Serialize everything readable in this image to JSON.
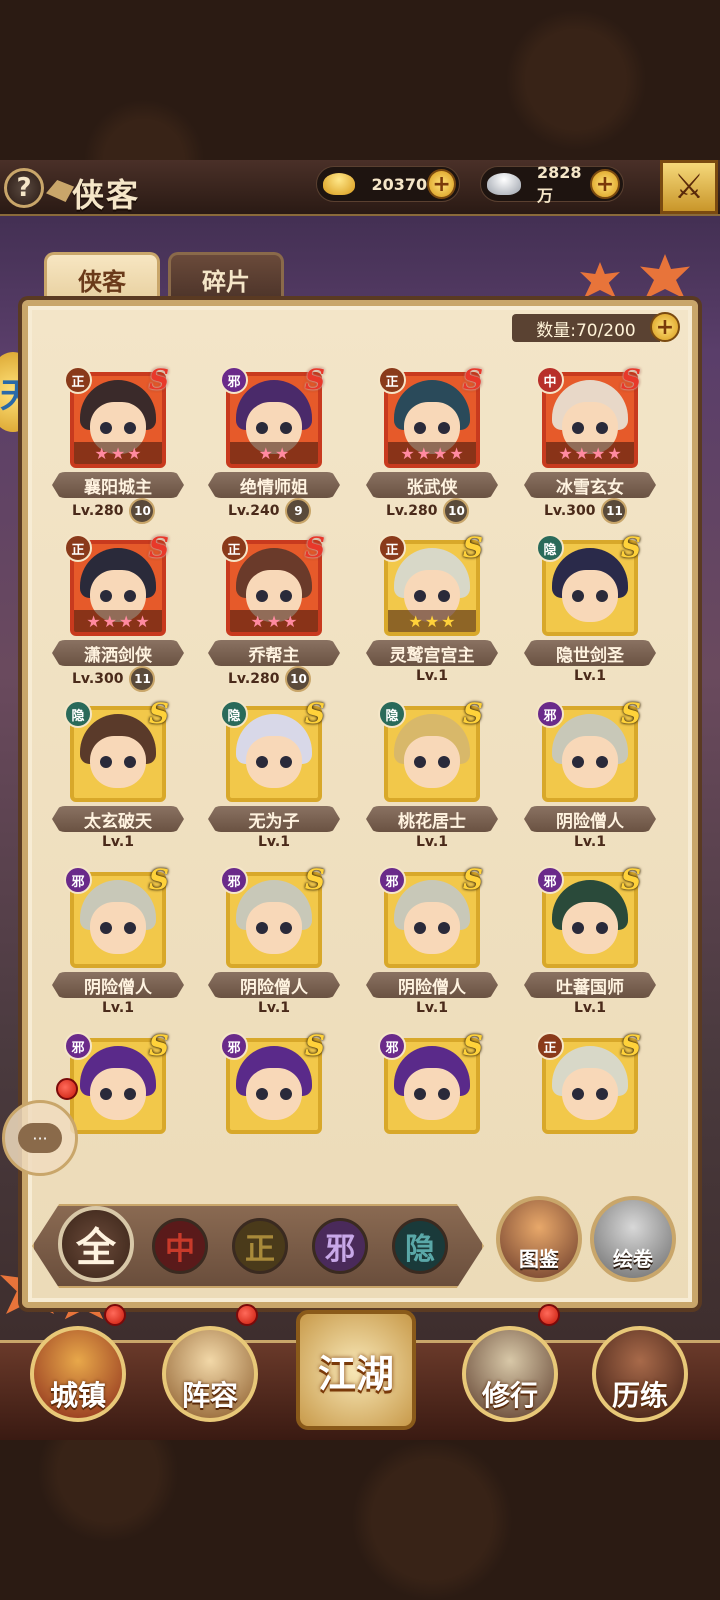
{
  "header": {
    "title": "侠客",
    "gold": "20370",
    "silver": "2828万",
    "help_icon": "question-icon",
    "close_icon": "crossed-swords-icon"
  },
  "tabs": [
    {
      "label": "侠客",
      "active": true
    },
    {
      "label": "碎片",
      "active": false
    }
  ],
  "count_label": "数量:70/200",
  "left_emblem": "天",
  "heroes": [
    {
      "name": "襄阳城主",
      "level": "Lv.280",
      "awaken": "10",
      "faction": "正",
      "rank": "S",
      "rank_color": "red",
      "stars": 3,
      "star_color": "pink",
      "frame": "red"
    },
    {
      "name": "绝情师姐",
      "level": "Lv.240",
      "awaken": "9",
      "faction": "邪",
      "rank": "S",
      "rank_color": "red",
      "stars": 2,
      "star_color": "pink",
      "frame": "red"
    },
    {
      "name": "张武侠",
      "level": "Lv.280",
      "awaken": "10",
      "faction": "正",
      "rank": "S",
      "rank_color": "red",
      "stars": 4,
      "star_color": "pink",
      "frame": "red"
    },
    {
      "name": "冰雪玄女",
      "level": "Lv.300",
      "awaken": "11",
      "faction": "中",
      "rank": "S",
      "rank_color": "red",
      "stars": 4,
      "star_color": "pink",
      "frame": "red"
    },
    {
      "name": "潇洒剑侠",
      "level": "Lv.300",
      "awaken": "11",
      "faction": "正",
      "rank": "S",
      "rank_color": "red",
      "stars": 4,
      "star_color": "pink",
      "frame": "red"
    },
    {
      "name": "乔帮主",
      "level": "Lv.280",
      "awaken": "10",
      "faction": "正",
      "rank": "S",
      "rank_color": "red",
      "stars": 3,
      "star_color": "pink",
      "frame": "red"
    },
    {
      "name": "灵鹫宫宫主",
      "level": "Lv.1",
      "awaken": "",
      "faction": "正",
      "rank": "S",
      "rank_color": "gold",
      "stars": 3,
      "star_color": "gold",
      "frame": "gold"
    },
    {
      "name": "隐世剑圣",
      "level": "Lv.1",
      "awaken": "",
      "faction": "隐",
      "rank": "S",
      "rank_color": "gold",
      "stars": 0,
      "star_color": "gold",
      "frame": "gold"
    },
    {
      "name": "太玄破天",
      "level": "Lv.1",
      "awaken": "",
      "faction": "隐",
      "rank": "S",
      "rank_color": "gold",
      "stars": 0,
      "star_color": "gold",
      "frame": "gold"
    },
    {
      "name": "无为子",
      "level": "Lv.1",
      "awaken": "",
      "faction": "隐",
      "rank": "S",
      "rank_color": "gold",
      "stars": 0,
      "star_color": "gold",
      "frame": "gold"
    },
    {
      "name": "桃花居士",
      "level": "Lv.1",
      "awaken": "",
      "faction": "隐",
      "rank": "S",
      "rank_color": "gold",
      "stars": 0,
      "star_color": "gold",
      "frame": "gold"
    },
    {
      "name": "阴险僧人",
      "level": "Lv.1",
      "awaken": "",
      "faction": "邪",
      "rank": "S",
      "rank_color": "gold",
      "stars": 0,
      "star_color": "gold",
      "frame": "gold"
    },
    {
      "name": "阴险僧人",
      "level": "Lv.1",
      "awaken": "",
      "faction": "邪",
      "rank": "S",
      "rank_color": "gold",
      "stars": 0,
      "star_color": "gold",
      "frame": "gold"
    },
    {
      "name": "阴险僧人",
      "level": "Lv.1",
      "awaken": "",
      "faction": "邪",
      "rank": "S",
      "rank_color": "gold",
      "stars": 0,
      "star_color": "gold",
      "frame": "gold"
    },
    {
      "name": "阴险僧人",
      "level": "Lv.1",
      "awaken": "",
      "faction": "邪",
      "rank": "S",
      "rank_color": "gold",
      "stars": 0,
      "star_color": "gold",
      "frame": "gold"
    },
    {
      "name": "吐蕃国师",
      "level": "Lv.1",
      "awaken": "",
      "faction": "邪",
      "rank": "S",
      "rank_color": "gold",
      "stars": 0,
      "star_color": "gold",
      "frame": "gold"
    },
    {
      "name": "",
      "level": "",
      "awaken": "",
      "faction": "邪",
      "rank": "S",
      "rank_color": "gold",
      "stars": 0,
      "star_color": "gold",
      "frame": "gold"
    },
    {
      "name": "",
      "level": "",
      "awaken": "",
      "faction": "邪",
      "rank": "S",
      "rank_color": "gold",
      "stars": 0,
      "star_color": "gold",
      "frame": "gold"
    },
    {
      "name": "",
      "level": "",
      "awaken": "",
      "faction": "邪",
      "rank": "S",
      "rank_color": "gold",
      "stars": 0,
      "star_color": "gold",
      "frame": "gold"
    },
    {
      "name": "",
      "level": "",
      "awaken": "",
      "faction": "正",
      "rank": "S",
      "rank_color": "gold",
      "stars": 0,
      "star_color": "gold",
      "frame": "gold"
    }
  ],
  "filters": [
    "全",
    "中",
    "正",
    "邪",
    "隐"
  ],
  "side_buttons": {
    "tujian": "图鉴",
    "huijuan": "绘卷"
  },
  "chat": "···",
  "nav": {
    "town": "城镇",
    "team": "阵容",
    "jianghu": "江湖",
    "train": "修行",
    "exp": "历练"
  }
}
